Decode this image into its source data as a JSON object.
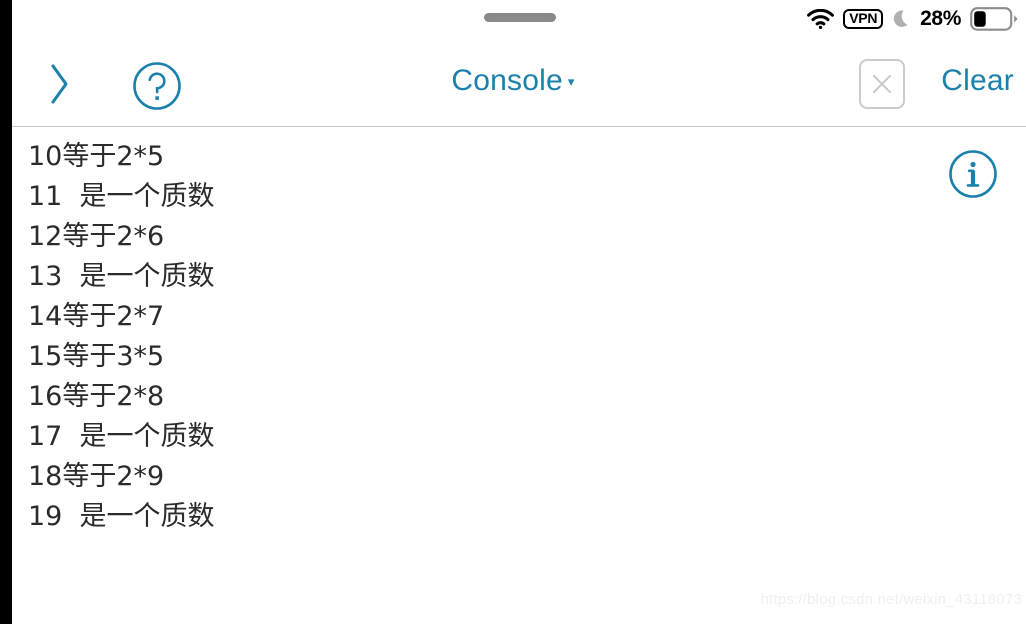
{
  "status_bar": {
    "wifi_icon": "wifi-icon",
    "vpn_label": "VPN",
    "dnd_icon": "crescent-moon-icon",
    "battery_percent": "28%",
    "battery_level": 28,
    "drag_handle": "drag-handle"
  },
  "toolbar": {
    "back_icon": "chevron-right-icon",
    "help_icon": "question-mark-circle-icon",
    "title": "Console",
    "title_caret": "▾",
    "close_icon": "close-x-icon",
    "clear_label": "Clear"
  },
  "console": {
    "info_icon": "info-circle-icon",
    "lines": [
      "10等于2*5",
      "11  是一个质数",
      "12等于2*6",
      "13  是一个质数",
      "14等于2*7",
      "15等于3*5",
      "16等于2*8",
      "17  是一个质数",
      "18等于2*9",
      "19  是一个质数"
    ],
    "watermark": "https://blog.csdn.net/weixin_43118073"
  },
  "colors": {
    "accent": "#1b81ab",
    "text": "#2b2b2b",
    "disabled": "#cccccc",
    "separator": "#c8c8c8",
    "handle": "#8a8a8a",
    "watermark": "#f0f0f0"
  }
}
